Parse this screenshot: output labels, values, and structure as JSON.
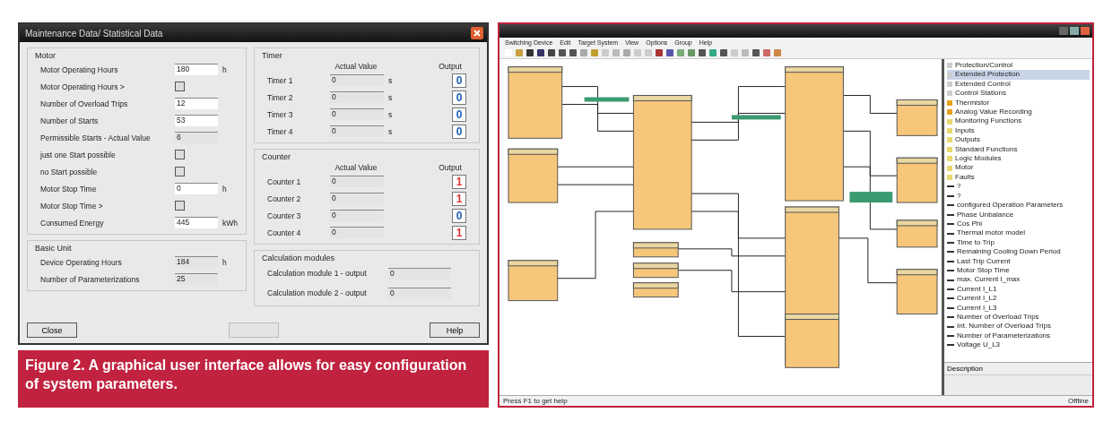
{
  "dialog": {
    "title": "Maintenance Data/ Statistical Data",
    "motor": {
      "title": "Motor",
      "rows": [
        {
          "kind": "field",
          "label": "Motor Operating Hours",
          "value": "180",
          "unit": "h",
          "editable": true
        },
        {
          "kind": "check",
          "label": "Motor Operating Hours >",
          "checked": false
        },
        {
          "kind": "field",
          "label": "Number of Overload Trips",
          "value": "12",
          "editable": true
        },
        {
          "kind": "field",
          "label": "Number of Starts",
          "value": "53",
          "editable": true
        },
        {
          "kind": "field",
          "label": "Permissible Starts - Actual Value",
          "value": "6",
          "editable": false
        },
        {
          "kind": "check",
          "label": "just one Start possible",
          "checked": false
        },
        {
          "kind": "check",
          "label": "no Start possible",
          "checked": false
        },
        {
          "kind": "field",
          "label": "Motor Stop Time",
          "value": "0",
          "unit": "h",
          "editable": true
        },
        {
          "kind": "check",
          "label": "Motor Stop Time >",
          "checked": false
        },
        {
          "kind": "field",
          "label": "Consumed Energy",
          "value": "445",
          "unit": "kWh",
          "editable": true
        }
      ]
    },
    "basic_unit": {
      "title": "Basic Unit",
      "rows": [
        {
          "kind": "field",
          "label": "Device Operating Hours",
          "value": "184",
          "unit": "h",
          "editable": false
        },
        {
          "kind": "field",
          "label": "Number of Parameterizations",
          "value": "25",
          "editable": false
        }
      ]
    },
    "timer": {
      "title": "Timer",
      "value_heading": "Actual Value",
      "output_heading": "Output",
      "rows": [
        {
          "label": "Timer 1",
          "value": "0",
          "unit": "s",
          "output": "0",
          "on": false
        },
        {
          "label": "Timer 2",
          "value": "0",
          "unit": "s",
          "output": "0",
          "on": false
        },
        {
          "label": "Timer 3",
          "value": "0",
          "unit": "s",
          "output": "0",
          "on": false
        },
        {
          "label": "Timer 4",
          "value": "0",
          "unit": "s",
          "output": "0",
          "on": false
        }
      ]
    },
    "counter": {
      "title": "Counter",
      "value_heading": "Actual Value",
      "output_heading": "Output",
      "rows": [
        {
          "label": "Counter 1",
          "value": "0",
          "output": "1",
          "on": true
        },
        {
          "label": "Counter 2",
          "value": "0",
          "output": "1",
          "on": true
        },
        {
          "label": "Counter 3",
          "value": "0",
          "output": "0",
          "on": false
        },
        {
          "label": "Counter 4",
          "value": "0",
          "output": "1",
          "on": true
        }
      ]
    },
    "calculation": {
      "title": "Calculation modules",
      "rows": [
        {
          "label": "Calculation module 1 - output",
          "value": "0"
        },
        {
          "label": "Calculation module 2 - output",
          "value": "0"
        }
      ]
    },
    "buttons": [
      {
        "label": "Close",
        "disabled": false
      },
      {
        "disabled": true
      },
      {
        "label": "Help",
        "disabled": false
      }
    ]
  },
  "caption": "Figure 2. A graphical user interface allows for easy configuration of system parameters.",
  "editor": {
    "menu": [
      "Switching Device",
      "Edit",
      "Target System",
      "View",
      "Options",
      "Group",
      "Help"
    ],
    "tree": [
      {
        "kind": "item",
        "label": "Protection/Control",
        "selected": false
      },
      {
        "kind": "item",
        "label": "Extended Protection",
        "selected": true
      },
      {
        "kind": "item",
        "label": "Extended Control",
        "selected": false
      },
      {
        "kind": "item",
        "label": "Control Stations",
        "selected": false
      },
      {
        "kind": "module",
        "label": "Thermistor",
        "selected": false
      },
      {
        "kind": "module",
        "label": "Analog Value Recording",
        "selected": false
      },
      {
        "kind": "folder",
        "label": "Monitoring Functions",
        "selected": false
      },
      {
        "kind": "folder",
        "label": "Inputs",
        "selected": false
      },
      {
        "kind": "folder",
        "label": "Outputs",
        "selected": false
      },
      {
        "kind": "folder",
        "label": "Standard Functions",
        "selected": false
      },
      {
        "kind": "folder",
        "label": "Logic Modules",
        "selected": false
      },
      {
        "kind": "folder",
        "label": "Motor",
        "selected": false
      },
      {
        "kind": "folder",
        "label": "Faults",
        "selected": false
      },
      {
        "kind": "param",
        "label": "?",
        "selected": false
      },
      {
        "kind": "param",
        "label": "?",
        "selected": false
      },
      {
        "kind": "param",
        "label": "configured Operation Parameters",
        "selected": false
      },
      {
        "kind": "param",
        "label": "Phase Unbalance",
        "selected": false
      },
      {
        "kind": "param",
        "label": "Cos Phi",
        "selected": false
      },
      {
        "kind": "param",
        "label": "Thermal motor model",
        "selected": false
      },
      {
        "kind": "param",
        "label": "Time to Trip",
        "selected": false
      },
      {
        "kind": "param",
        "label": "Remaining Cooling Down Period",
        "selected": false
      },
      {
        "kind": "param",
        "label": "Last Trip Current",
        "selected": false
      },
      {
        "kind": "param",
        "label": "Motor Stop Time",
        "selected": false
      },
      {
        "kind": "param",
        "label": "max. Current I_max",
        "selected": false
      },
      {
        "kind": "param",
        "label": "Current I_L1",
        "selected": false
      },
      {
        "kind": "param",
        "label": "Current I_L2",
        "selected": false
      },
      {
        "kind": "param",
        "label": "Current I_L3",
        "selected": false
      },
      {
        "kind": "param",
        "label": "Number of Overload Trips",
        "selected": false
      },
      {
        "kind": "param",
        "label": "Int. Number of Overload Trips",
        "selected": false
      },
      {
        "kind": "param",
        "label": "Number of Parameterizations",
        "selected": false
      },
      {
        "kind": "param",
        "label": "Voltage U_L3",
        "selected": false
      }
    ],
    "description_title": "Description",
    "status_left": "Press F1 to get help",
    "status_right": "Offline"
  }
}
